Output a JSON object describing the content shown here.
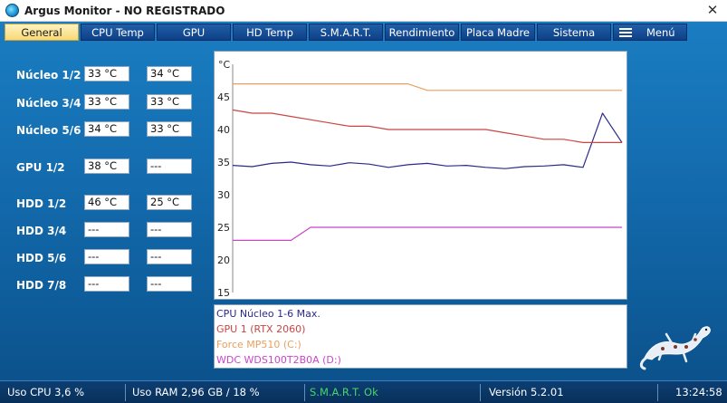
{
  "window": {
    "title": "Argus Monitor - NO REGISTRADO",
    "close": "✕"
  },
  "tabs": [
    {
      "label": "General",
      "active": true
    },
    {
      "label": "CPU Temp"
    },
    {
      "label": "GPU"
    },
    {
      "label": "HD Temp"
    },
    {
      "label": "S.M.A.R.T."
    },
    {
      "label": "Rendimiento"
    },
    {
      "label": "Placa Madre"
    },
    {
      "label": "Sistema"
    },
    {
      "label": "Menú",
      "icon": "hamburger-menu-icon"
    }
  ],
  "sensors": [
    {
      "label": "Núcleo 1/2",
      "v1": "33 °C",
      "v2": "34 °C"
    },
    {
      "label": "Núcleo 3/4",
      "v1": "33 °C",
      "v2": "33 °C"
    },
    {
      "label": "Núcleo 5/6",
      "v1": "34 °C",
      "v2": "33 °C"
    },
    {
      "label": "GPU 1/2",
      "v1": "38 °C",
      "v2": "---"
    },
    {
      "label": "HDD 1/2",
      "v1": "46 °C",
      "v2": "25 °C"
    },
    {
      "label": "HDD 3/4",
      "v1": "---",
      "v2": "---"
    },
    {
      "label": "HDD 5/6",
      "v1": "---",
      "v2": "---"
    },
    {
      "label": "HDD 7/8",
      "v1": "---",
      "v2": "---"
    }
  ],
  "chart_data": {
    "type": "line",
    "ylabel": "°C",
    "ylim": [
      15,
      50
    ],
    "yticks": [
      15,
      20,
      25,
      30,
      35,
      40,
      45
    ],
    "x": [
      0,
      5,
      10,
      15,
      20,
      25,
      30,
      35,
      40,
      45,
      50,
      55,
      60,
      65,
      70,
      75,
      80,
      85,
      90,
      95,
      100
    ],
    "series": [
      {
        "name": "CPU Núcleo 1-6 Max.",
        "color": "#2a2a8a",
        "values": [
          34.5,
          34.3,
          34.8,
          35.0,
          34.6,
          34.4,
          34.9,
          34.7,
          34.2,
          34.6,
          34.8,
          34.4,
          34.5,
          34.2,
          34.0,
          34.3,
          34.4,
          34.6,
          34.2,
          42.5,
          38.0
        ]
      },
      {
        "name": "GPU 1 (RTX 2060)",
        "color": "#cc4444",
        "values": [
          43,
          42.5,
          42.5,
          42,
          41.5,
          41,
          40.5,
          40.5,
          40,
          40,
          40,
          40,
          40,
          40,
          39.5,
          39,
          38.5,
          38.5,
          38,
          38,
          38
        ]
      },
      {
        "name": "Force MP510 (C:)",
        "color": "#e8a060",
        "values": [
          47,
          47,
          47,
          47,
          47,
          47,
          47,
          47,
          47,
          47,
          46,
          46,
          46,
          46,
          46,
          46,
          46,
          46,
          46,
          46,
          46
        ]
      },
      {
        "name": "WDC WDS100T2B0A (D:)",
        "color": "#cc44cc",
        "values": [
          23,
          23,
          23,
          23,
          25,
          25,
          25,
          25,
          25,
          25,
          25,
          25,
          25,
          25,
          25,
          25,
          25,
          25,
          25,
          25,
          25
        ]
      }
    ]
  },
  "legend": [
    {
      "label": "CPU Núcleo 1-6 Max.",
      "color": "#2a2a8a"
    },
    {
      "label": "GPU 1 (RTX 2060)",
      "color": "#cc4444"
    },
    {
      "label": "Force MP510 (C:)",
      "color": "#e8a060"
    },
    {
      "label": "WDC WDS100T2B0A (D:)",
      "color": "#cc44cc"
    }
  ],
  "status": {
    "cpu": "Uso CPU 3,6 %",
    "ram": "Uso RAM 2,96 GB / 18 %",
    "smart": "S.M.A.R.T. Ok",
    "version": "Versión 5.2.01",
    "clock": "13:24:58"
  },
  "colors": {
    "smart_ok": "#44d66a",
    "active_tab": "#f7d873"
  }
}
